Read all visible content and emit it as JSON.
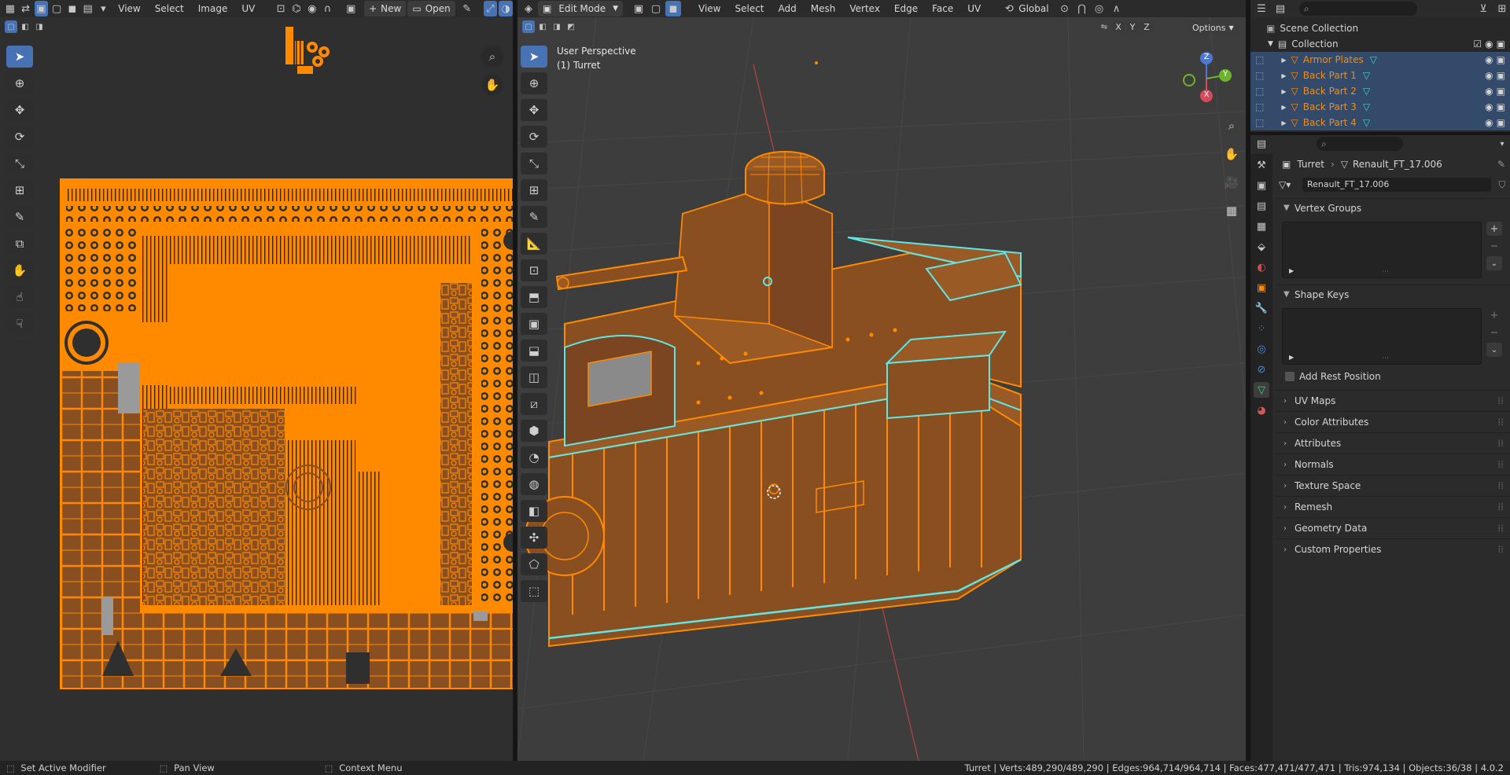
{
  "colors": {
    "accent": "#4772b3",
    "selection_orange": "#ff8a00",
    "mesh_fill": "#8a4f21",
    "edge_cyan": "#5fe6e6",
    "panel_bg": "#2b2b2b",
    "viewport_bg": "#3d3d3d",
    "uv_bg": "#2f2f2f"
  },
  "uv_editor": {
    "menus": [
      "View",
      "Select",
      "Image",
      "UV"
    ],
    "new_label": "New",
    "open_label": "Open"
  },
  "viewport": {
    "mode": "Edit Mode",
    "menus": [
      "View",
      "Select",
      "Add",
      "Mesh",
      "Vertex",
      "Edge",
      "Face",
      "UV"
    ],
    "transform_orientation": "Global",
    "axis_x": "X",
    "axis_y": "Y",
    "axis_z": "Z",
    "options_label": "Options",
    "view_name": "User Perspective",
    "object_name": "(1) Turret",
    "gizmo_z": "Z",
    "gizmo_y": "Y",
    "gizmo_x": "X"
  },
  "outliner": {
    "scene_collection": "Scene Collection",
    "collection": "Collection",
    "items": [
      "Armor Plates",
      "Back Part 1",
      "Back Part 2",
      "Back Part 3",
      "Back Part 4"
    ]
  },
  "properties": {
    "breadcrumb_object": "Turret",
    "breadcrumb_mesh": "Renault_FT_17.006",
    "mesh_name": "Renault_FT_17.006",
    "vertex_groups": "Vertex Groups",
    "shape_keys": "Shape Keys",
    "add_rest_position": "Add Rest Position",
    "collapsed_panels": [
      "UV Maps",
      "Color Attributes",
      "Attributes",
      "Normals",
      "Texture Space",
      "Remesh",
      "Geometry Data",
      "Custom Properties"
    ]
  },
  "status_bar": {
    "hint_left": "Set Active Modifier",
    "hint_mid": "Pan View",
    "hint_right": "Context Menu",
    "stats": "Turret | Verts:489,290/489,290 | Edges:964,714/964,714 | Faces:477,471/477,471 | Tris:974,134 | Objects:36/38 | 4.0.2"
  }
}
